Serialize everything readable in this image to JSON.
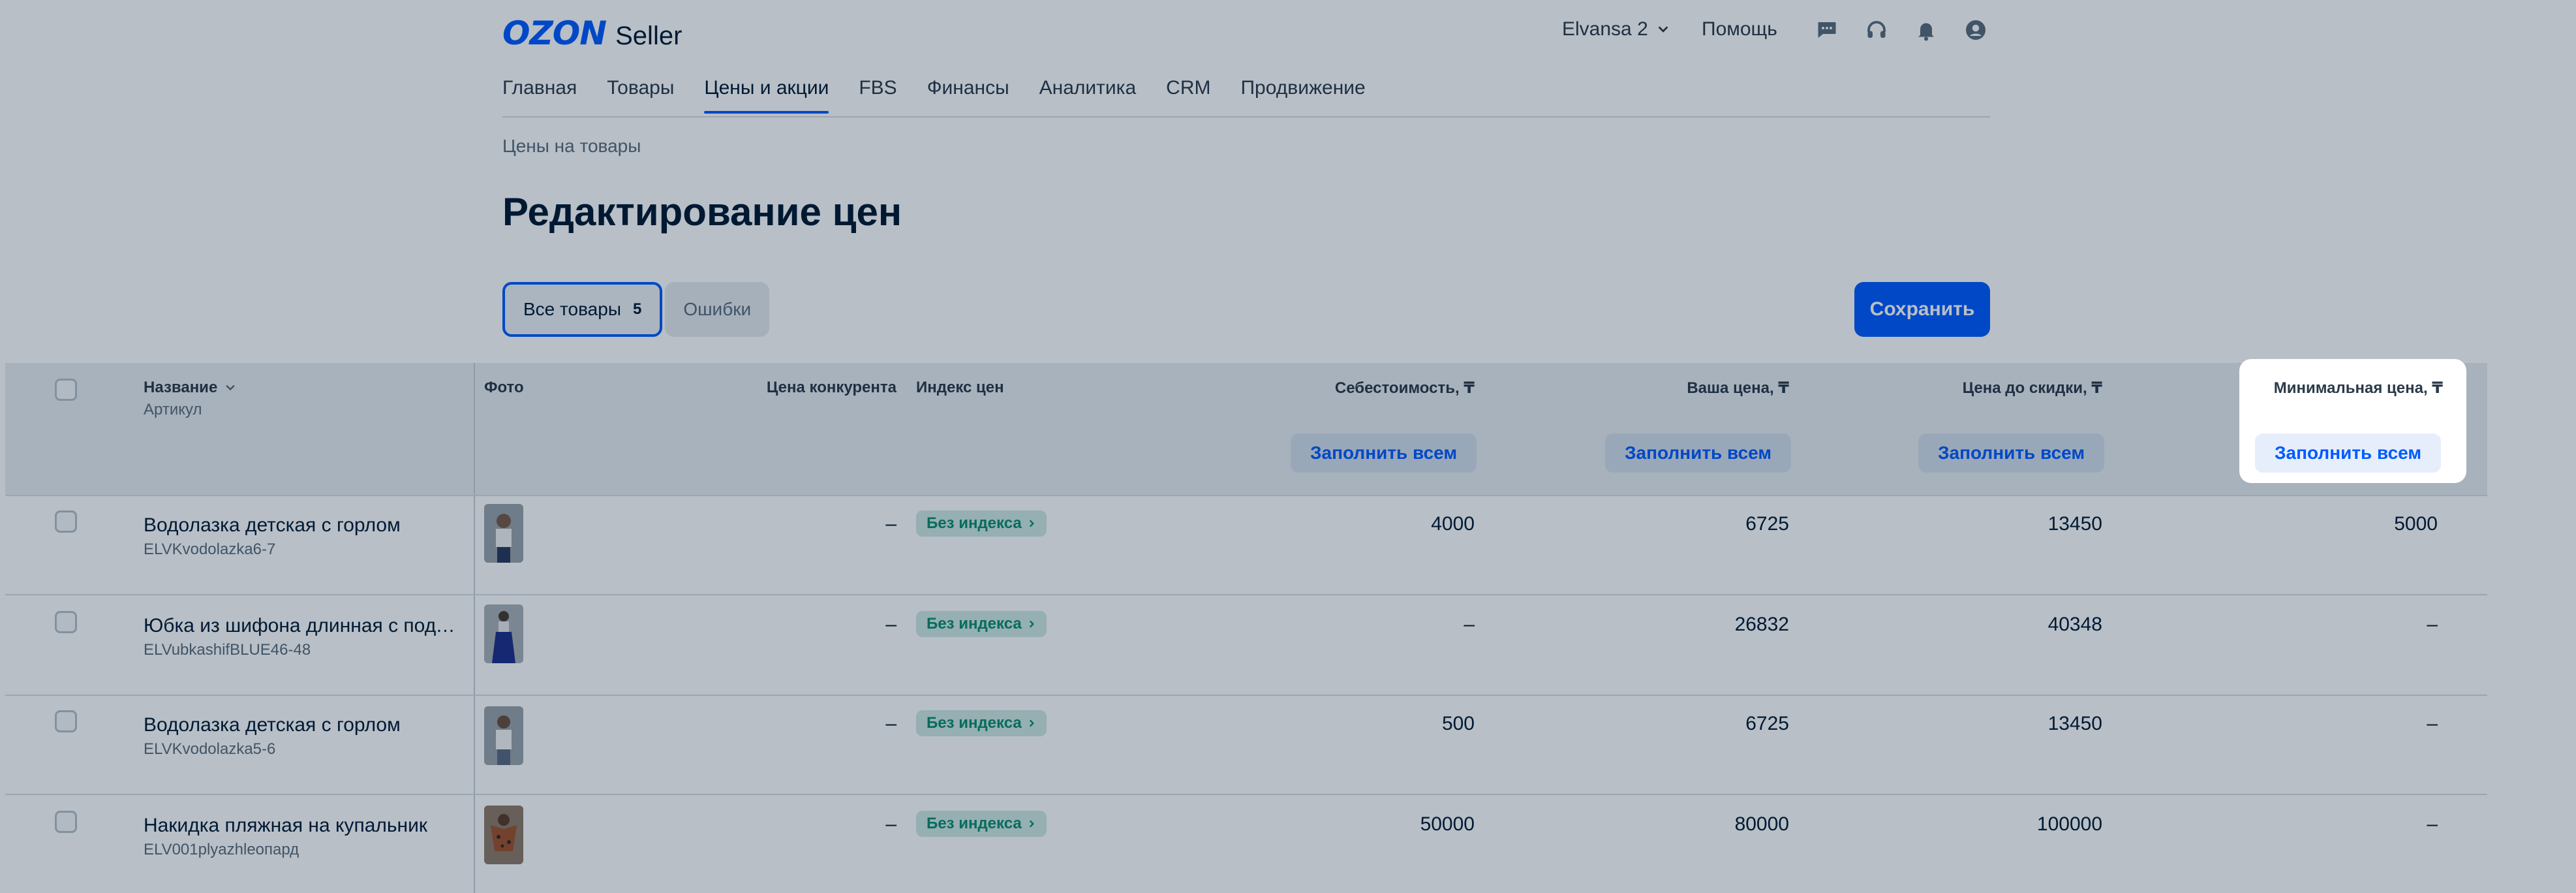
{
  "header": {
    "logo_brand": "OZON",
    "logo_product": "Seller",
    "account_name": "Elvansa 2",
    "help_label": "Помощь",
    "icons": [
      "chat-icon",
      "headset-icon",
      "bell-icon",
      "user-icon"
    ]
  },
  "nav": {
    "items": [
      "Главная",
      "Товары",
      "Цены и акции",
      "FBS",
      "Финансы",
      "Аналитика",
      "CRM",
      "Продвижение"
    ],
    "active": "Цены и акции"
  },
  "breadcrumb": "Цены на товары",
  "page_title": "Редактирование цен",
  "tabs": {
    "all_label": "Все товары",
    "all_count": "5",
    "errors_label": "Ошибки"
  },
  "save_label": "Сохранить",
  "table": {
    "headers": {
      "name": "Название",
      "article": "Артикул",
      "photo": "Фото",
      "competitor_price": "Цена конкурента",
      "price_index": "Индекс цен",
      "cost": "Себестоимость, ₸",
      "your_price": "Ваша цена, ₸",
      "price_before_discount": "Цена до скидки, ₸",
      "min_price": "Минимальная цена, ₸"
    },
    "fill_all_label": "Заполнить всем",
    "rows": [
      {
        "name": "Водолазка детская с горлом",
        "sku": "ELVKvodolazka6-7",
        "competitor": "–",
        "index": "Без индекса",
        "cost": "4000",
        "price": "6725",
        "old_price": "13450",
        "min_price": "5000"
      },
      {
        "name": "Юбка из шифона длинная с подъюбником",
        "sku": "ELVubkashifBLUE46-48",
        "competitor": "–",
        "index": "Без индекса",
        "cost": "–",
        "price": "26832",
        "old_price": "40348",
        "min_price": "–"
      },
      {
        "name": "Водолазка детская с горлом",
        "sku": "ELVKvodolazka5-6",
        "competitor": "–",
        "index": "Без индекса",
        "cost": "500",
        "price": "6725",
        "old_price": "13450",
        "min_price": "–"
      },
      {
        "name": "Накидка пляжная на купальник",
        "sku": "ELV001plyazhleопард",
        "competitor": "–",
        "index": "Без индекса",
        "cost": "50000",
        "price": "80000",
        "old_price": "100000",
        "min_price": "–"
      }
    ]
  },
  "colors": {
    "accent": "#005bff",
    "badge_bg": "#cfe9e4",
    "badge_text": "#0a8c6e",
    "overlay": "#001a34"
  }
}
